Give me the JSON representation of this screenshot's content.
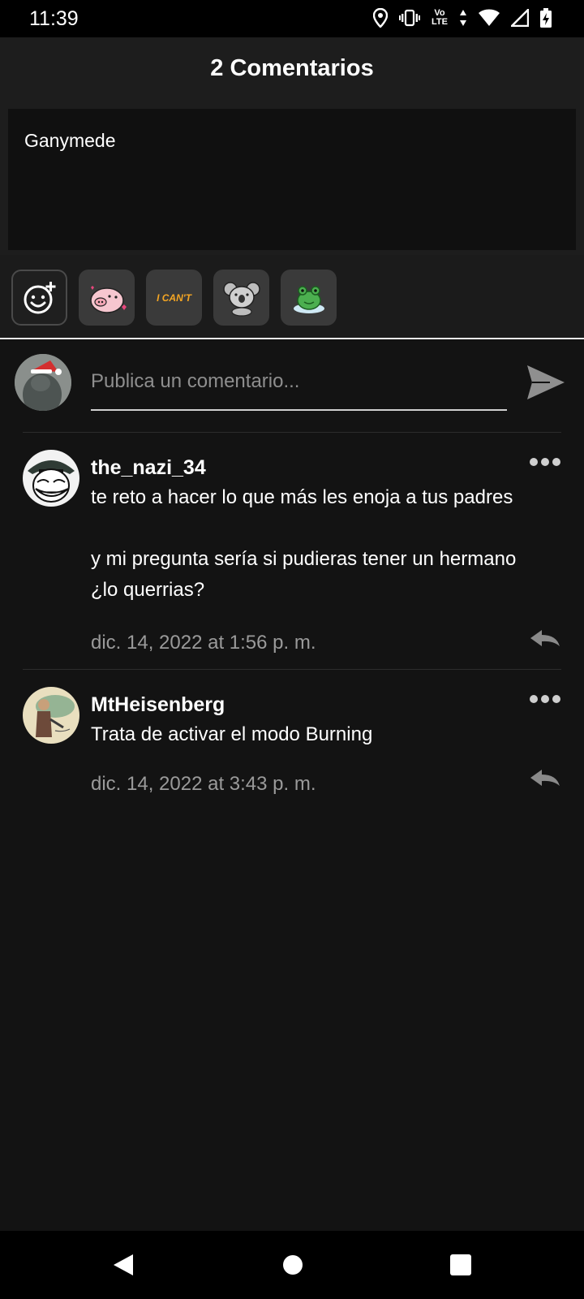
{
  "status_bar": {
    "time": "11:39",
    "lte_top": "Vo",
    "lte_bottom": "LTE",
    "icons": [
      "location-icon",
      "vibrate-icon",
      "volte-icon",
      "data-arrows-icon",
      "wifi-icon",
      "signal-icon",
      "battery-charging-icon"
    ]
  },
  "header": {
    "title": "2 Comentarios"
  },
  "post": {
    "text": "Ganymede"
  },
  "stickers": [
    {
      "name": "emoji-picker",
      "icon": "emoji-add-icon"
    },
    {
      "name": "sticker-pig",
      "icon": "pig-sticker"
    },
    {
      "name": "sticker-i-cant",
      "label": "I CAN'T"
    },
    {
      "name": "sticker-koala",
      "icon": "koala-sticker"
    },
    {
      "name": "sticker-frog",
      "icon": "frog-sticker"
    }
  ],
  "compose": {
    "placeholder": "Publica un comentario...",
    "send_icon": "send-icon"
  },
  "comments": [
    {
      "username": "the_nazi_34",
      "text": "te reto a hacer lo que más les enoja a tus padres\n\ny mi pregunta sería si pudieras tener un hermano ¿lo querrias?",
      "text_line1": "te reto a hacer lo que más les enoja a tus padres",
      "text_line2": "y mi pregunta sería si pudieras tener un hermano",
      "text_line3": "¿lo querrias?",
      "date": "dic. 14, 2022 at 1:56 p. m."
    },
    {
      "username": "MtHeisenberg",
      "text": "Trata de activar el modo Burning",
      "date": "dic. 14, 2022 at 3:43 p. m."
    }
  ],
  "nav": {
    "back": "back-icon",
    "home": "home-icon",
    "recents": "recents-icon"
  },
  "colors": {
    "background": "#131313",
    "header": "#1d1d1d",
    "muted_text": "#9a9a9a",
    "accent_underline": "#e9e9e9"
  }
}
